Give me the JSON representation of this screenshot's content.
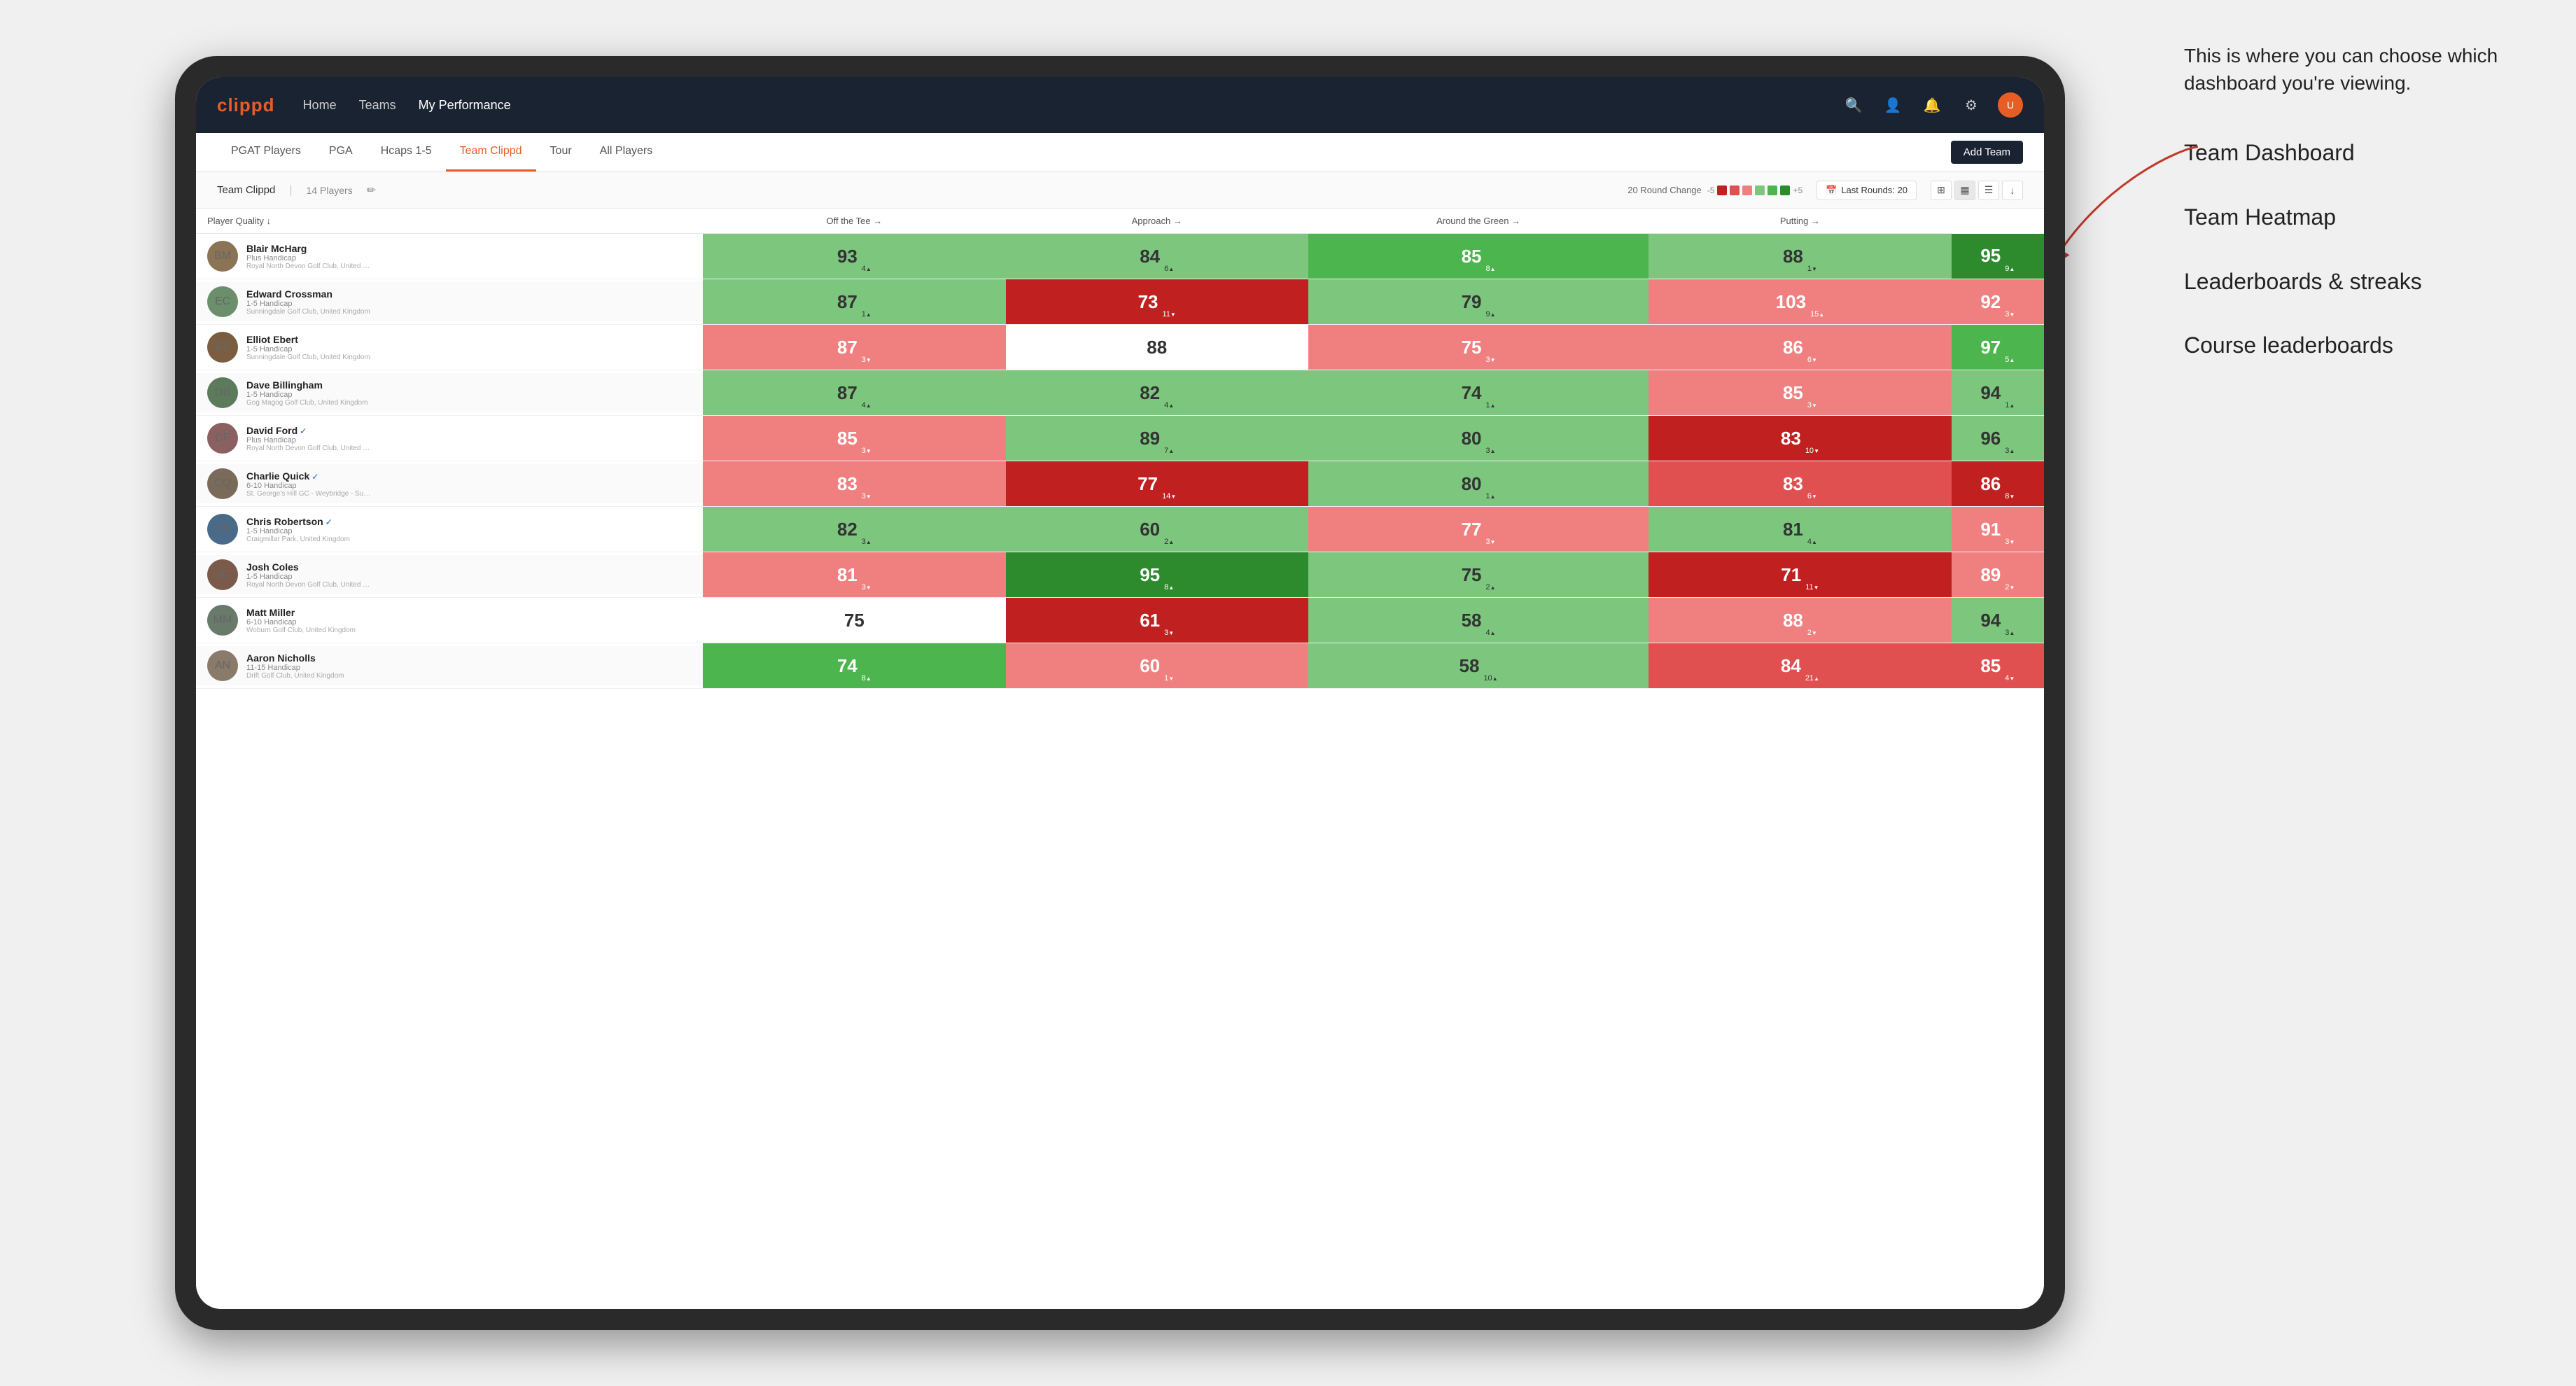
{
  "annotation": {
    "bubble_text": "This is where you can choose which dashboard you're viewing.",
    "items": [
      "Team Dashboard",
      "Team Heatmap",
      "Leaderboards & streaks",
      "Course leaderboards"
    ]
  },
  "nav": {
    "logo": "clippd",
    "links": [
      "Home",
      "Teams",
      "My Performance"
    ],
    "active_link": "My Performance"
  },
  "tabs": {
    "items": [
      "PGAT Players",
      "PGA",
      "Hcaps 1-5",
      "Team Clippd",
      "Tour",
      "All Players"
    ],
    "active": "Team Clippd"
  },
  "add_team_label": "Add Team",
  "toolbar": {
    "team_name": "Team Clippd",
    "separator": "|",
    "count": "14 Players",
    "round_change_label": "20 Round Change",
    "scale_min": "-5",
    "scale_max": "+5",
    "last_rounds_label": "Last Rounds: 20"
  },
  "table": {
    "headers": [
      "Player Quality ↓",
      "Off the Tee →",
      "Approach →",
      "Around the Green →",
      "Putting →"
    ],
    "rows": [
      {
        "name": "Blair McHarg",
        "handicap": "Plus Handicap",
        "club": "Royal North Devon Golf Club, United Kingdom",
        "avatar_bg": "#8B7355",
        "scores": [
          {
            "val": 93,
            "delta": "4",
            "dir": "up",
            "color": "green-light"
          },
          {
            "val": 84,
            "delta": "6",
            "dir": "up",
            "color": "green-light"
          },
          {
            "val": 85,
            "delta": "8",
            "dir": "up",
            "color": "green-mid"
          },
          {
            "val": 88,
            "delta": "1",
            "dir": "down",
            "color": "green-light"
          },
          {
            "val": 95,
            "delta": "9",
            "dir": "up",
            "color": "green-dark"
          }
        ]
      },
      {
        "name": "Edward Crossman",
        "handicap": "1-5 Handicap",
        "club": "Sunningdale Golf Club, United Kingdom",
        "avatar_bg": "#6B8E6B",
        "scores": [
          {
            "val": 87,
            "delta": "1",
            "dir": "up",
            "color": "green-light"
          },
          {
            "val": 73,
            "delta": "11",
            "dir": "down",
            "color": "red-dark"
          },
          {
            "val": 79,
            "delta": "9",
            "dir": "up",
            "color": "green-light"
          },
          {
            "val": 103,
            "delta": "15",
            "dir": "up",
            "color": "red-light"
          },
          {
            "val": 92,
            "delta": "3",
            "dir": "down",
            "color": "red-light"
          }
        ]
      },
      {
        "name": "Elliot Ebert",
        "handicap": "1-5 Handicap",
        "club": "Sunningdale Golf Club, United Kingdom",
        "avatar_bg": "#7B5E42",
        "scores": [
          {
            "val": 87,
            "delta": "3",
            "dir": "down",
            "color": "red-light"
          },
          {
            "val": 88,
            "delta": "",
            "dir": "",
            "color": "neutral"
          },
          {
            "val": 75,
            "delta": "3",
            "dir": "down",
            "color": "red-light"
          },
          {
            "val": 86,
            "delta": "6",
            "dir": "down",
            "color": "red-light"
          },
          {
            "val": 97,
            "delta": "5",
            "dir": "up",
            "color": "green-mid"
          }
        ]
      },
      {
        "name": "Dave Billingham",
        "handicap": "1-5 Handicap",
        "club": "Gog Magog Golf Club, United Kingdom",
        "avatar_bg": "#5C7A5C",
        "scores": [
          {
            "val": 87,
            "delta": "4",
            "dir": "up",
            "color": "green-light"
          },
          {
            "val": 82,
            "delta": "4",
            "dir": "up",
            "color": "green-light"
          },
          {
            "val": 74,
            "delta": "1",
            "dir": "up",
            "color": "green-light"
          },
          {
            "val": 85,
            "delta": "3",
            "dir": "down",
            "color": "red-light"
          },
          {
            "val": 94,
            "delta": "1",
            "dir": "up",
            "color": "green-light"
          }
        ]
      },
      {
        "name": "David Ford",
        "handicap": "Plus Handicap",
        "club": "Royal North Devon Golf Club, United Kingdom",
        "avatar_bg": "#8B6060",
        "verified": true,
        "scores": [
          {
            "val": 85,
            "delta": "3",
            "dir": "down",
            "color": "red-light"
          },
          {
            "val": 89,
            "delta": "7",
            "dir": "up",
            "color": "green-light"
          },
          {
            "val": 80,
            "delta": "3",
            "dir": "up",
            "color": "green-light"
          },
          {
            "val": 83,
            "delta": "10",
            "dir": "down",
            "color": "red-dark"
          },
          {
            "val": 96,
            "delta": "3",
            "dir": "up",
            "color": "green-light"
          }
        ]
      },
      {
        "name": "Charlie Quick",
        "handicap": "6-10 Handicap",
        "club": "St. George's Hill GC - Weybridge - Surrey, Uni...",
        "avatar_bg": "#7A6A5A",
        "verified": true,
        "scores": [
          {
            "val": 83,
            "delta": "3",
            "dir": "down",
            "color": "red-light"
          },
          {
            "val": 77,
            "delta": "14",
            "dir": "down",
            "color": "red-dark"
          },
          {
            "val": 80,
            "delta": "1",
            "dir": "up",
            "color": "green-light"
          },
          {
            "val": 83,
            "delta": "6",
            "dir": "down",
            "color": "red-mid"
          },
          {
            "val": 86,
            "delta": "8",
            "dir": "down",
            "color": "red-dark"
          }
        ]
      },
      {
        "name": "Chris Robertson",
        "handicap": "1-5 Handicap",
        "club": "Craigmillar Park, United Kingdom",
        "avatar_bg": "#4A6A8A",
        "verified": true,
        "scores": [
          {
            "val": 82,
            "delta": "3",
            "dir": "up",
            "color": "green-light"
          },
          {
            "val": 60,
            "delta": "2",
            "dir": "up",
            "color": "green-light"
          },
          {
            "val": 77,
            "delta": "3",
            "dir": "down",
            "color": "red-light"
          },
          {
            "val": 81,
            "delta": "4",
            "dir": "up",
            "color": "green-light"
          },
          {
            "val": 91,
            "delta": "3",
            "dir": "down",
            "color": "red-light"
          }
        ]
      },
      {
        "name": "Josh Coles",
        "handicap": "1-5 Handicap",
        "club": "Royal North Devon Golf Club, United Kingdom",
        "avatar_bg": "#7A5A4A",
        "scores": [
          {
            "val": 81,
            "delta": "3",
            "dir": "down",
            "color": "red-light"
          },
          {
            "val": 95,
            "delta": "8",
            "dir": "up",
            "color": "green-dark"
          },
          {
            "val": 75,
            "delta": "2",
            "dir": "up",
            "color": "green-light"
          },
          {
            "val": 71,
            "delta": "11",
            "dir": "down",
            "color": "red-dark"
          },
          {
            "val": 89,
            "delta": "2",
            "dir": "down",
            "color": "red-light"
          }
        ]
      },
      {
        "name": "Matt Miller",
        "handicap": "6-10 Handicap",
        "club": "Woburn Golf Club, United Kingdom",
        "avatar_bg": "#6A7A6A",
        "scores": [
          {
            "val": 75,
            "delta": "",
            "dir": "",
            "color": "neutral"
          },
          {
            "val": 61,
            "delta": "3",
            "dir": "down",
            "color": "red-dark"
          },
          {
            "val": 58,
            "delta": "4",
            "dir": "up",
            "color": "green-light"
          },
          {
            "val": 88,
            "delta": "2",
            "dir": "down",
            "color": "red-light"
          },
          {
            "val": 94,
            "delta": "3",
            "dir": "up",
            "color": "green-light"
          }
        ]
      },
      {
        "name": "Aaron Nicholls",
        "handicap": "11-15 Handicap",
        "club": "Drift Golf Club, United Kingdom",
        "avatar_bg": "#8A7A6A",
        "scores": [
          {
            "val": 74,
            "delta": "8",
            "dir": "up",
            "color": "green-mid"
          },
          {
            "val": 60,
            "delta": "1",
            "dir": "down",
            "color": "red-light"
          },
          {
            "val": 58,
            "delta": "10",
            "dir": "up",
            "color": "green-light"
          },
          {
            "val": 84,
            "delta": "21",
            "dir": "up",
            "color": "red-mid"
          },
          {
            "val": 85,
            "delta": "4",
            "dir": "down",
            "color": "red-mid"
          }
        ]
      }
    ]
  },
  "colors": {
    "green_light": "#7dc67e",
    "green_mid": "#4db54d",
    "green_dark": "#2d8a2d",
    "red_light": "#f08080",
    "red_mid": "#e05050",
    "red_dark": "#c02020",
    "neutral": "#ffffff",
    "nav_bg": "#1a2332",
    "accent": "#e85d26"
  }
}
